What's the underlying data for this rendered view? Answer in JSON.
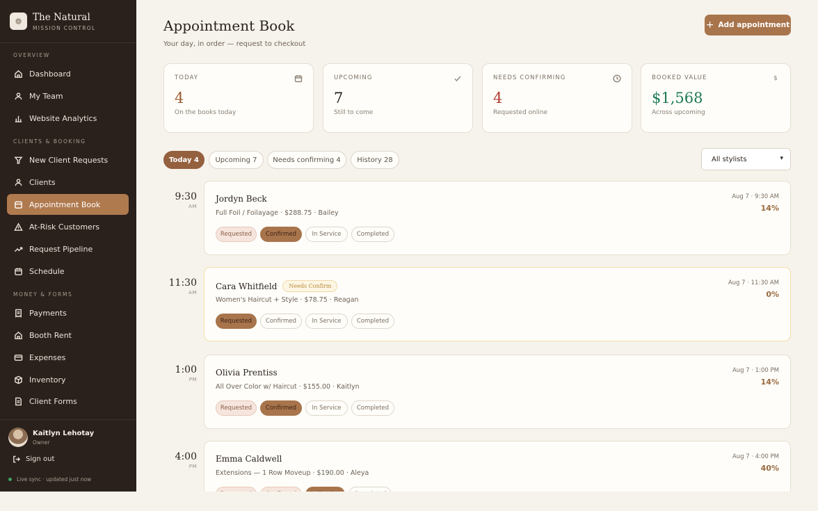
{
  "brand": {
    "name": "The Natural",
    "sub": "MISSION CONTROL"
  },
  "sidebar": {
    "sections": [
      "OVERVIEW",
      "CLIENTS & BOOKING",
      "MONEY & FORMS"
    ],
    "items": [
      {
        "label": "Dashboard",
        "icon": "home-icon"
      },
      {
        "label": "My Team",
        "icon": "team-icon"
      },
      {
        "label": "Website Analytics",
        "icon": "bar-chart-icon"
      },
      {
        "label": "New Client Requests",
        "icon": "filter-icon"
      },
      {
        "label": "Clients",
        "icon": "users-icon"
      },
      {
        "label": "Appointment Book",
        "icon": "book-icon"
      },
      {
        "label": "At-Risk Customers",
        "icon": "warning-icon"
      },
      {
        "label": "Request Pipeline",
        "icon": "trend-icon"
      },
      {
        "label": "Schedule",
        "icon": "calendar-icon"
      },
      {
        "label": "Payments",
        "icon": "receipt-icon"
      },
      {
        "label": "Booth Rent",
        "icon": "house-icon"
      },
      {
        "label": "Expenses",
        "icon": "card-icon"
      },
      {
        "label": "Inventory",
        "icon": "box-icon"
      },
      {
        "label": "Client Forms",
        "icon": "document-icon"
      }
    ],
    "user": {
      "name": "Kaitlyn Lehotay",
      "role": "Owner"
    },
    "signout": "Sign out",
    "live": "Live sync · updated just now"
  },
  "header": {
    "title": "Appointment Book",
    "subtitle": "Your day, in order — request to checkout",
    "add_button": "Add appointment"
  },
  "stats": [
    {
      "label": "TODAY",
      "value": "4",
      "caption": "On the books today",
      "color": "#9a5a2e",
      "icon": "calendar-icon"
    },
    {
      "label": "UPCOMING",
      "value": "7",
      "caption": "Still to come",
      "color": "#2b221c",
      "icon": "check-icon"
    },
    {
      "label": "NEEDS CONFIRMING",
      "value": "4",
      "caption": "Requested online",
      "color": "#b23a2e",
      "icon": "clock-icon"
    },
    {
      "label": "BOOKED VALUE",
      "value": "$1,568",
      "caption": "Across upcoming",
      "color": "#1f7a55",
      "icon": "dollar-icon",
      "icon_glyph": "$"
    }
  ],
  "tabs": [
    "Today 4",
    "Upcoming 7",
    "Needs confirming 4",
    "History 28"
  ],
  "stylist_filter": "All stylists",
  "status_labels": [
    "Requested",
    "Confirmed",
    "In Service",
    "Completed"
  ],
  "appointments": [
    {
      "time": "9:30",
      "ampm": "AM",
      "name": "Jordyn Beck",
      "detail": "Full Foil / Foilayage · $288.75 · Bailey",
      "date": "Aug 7 · 9:30 AM",
      "pct": "14%",
      "badge": "",
      "state": "confirmed"
    },
    {
      "time": "11:30",
      "ampm": "AM",
      "name": "Cara Whitfield",
      "detail": "Women's Haircut + Style · $78.75 · Reagan",
      "date": "Aug 7 · 11:30 AM",
      "pct": "0%",
      "badge": "Needs Confirm",
      "state": "requested"
    },
    {
      "time": "1:00",
      "ampm": "PM",
      "name": "Olivia Prentiss",
      "detail": "All Over Color w/ Haircut · $155.00 · Kaitlyn",
      "date": "Aug 7 · 1:00 PM",
      "pct": "14%",
      "badge": "",
      "state": "confirmed"
    },
    {
      "time": "4:00",
      "ampm": "PM",
      "name": "Emma Caldwell",
      "detail": "Extensions — 1 Row Moveup · $190.00 · Aleya",
      "date": "Aug 7 · 4:00 PM",
      "pct": "40%",
      "badge": "",
      "state": "inservice"
    }
  ]
}
